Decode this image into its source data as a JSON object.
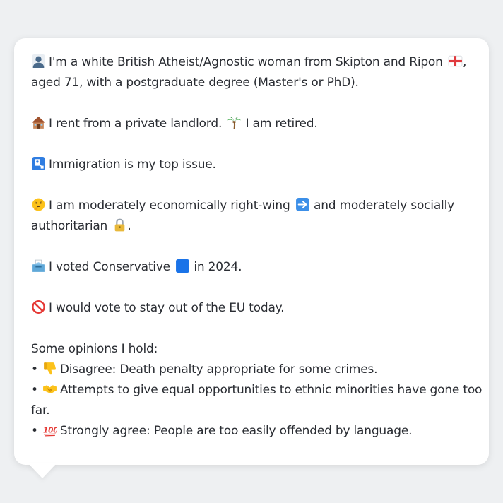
{
  "profile": {
    "intro_line1": "I'm a white British Atheist/Agnostic woman from Skipton and Ripon",
    "intro_line1_end": ",",
    "intro_line2": "aged 71, with a postgraduate degree (Master's or PhD).",
    "housing": "I rent from a private landlord.",
    "work": "I am retired.",
    "top_issue": "Immigration is my top issue.",
    "ideology_a": "I am moderately economically right-wing",
    "ideology_b": "and moderately socially",
    "ideology_c": "authoritarian",
    "ideology_c_end": ".",
    "vote_a": "I voted Conservative",
    "vote_b": "in 2024.",
    "eu": "I would vote to stay out of the EU today."
  },
  "opinions": {
    "heading": "Some opinions I hold:",
    "bullet": "•",
    "items": [
      {
        "line1": "Disagree: Death penalty appropriate for some crimes.",
        "line2": ""
      },
      {
        "line1": "Attempts to give equal opportunities to ethnic minorities have gone too",
        "line2": "far."
      },
      {
        "line1": "Strongly agree: People are too easily offended by language.",
        "line2": ""
      }
    ]
  },
  "icons": {
    "intro": "person-silhouette-icon",
    "flag": "england-flag-icon",
    "housing": "house-icon",
    "work": "palm-tree-icon",
    "top_issue": "passport-control-icon",
    "ideology": "thinking-face-icon",
    "economic": "right-arrow-icon",
    "social": "lock-icon",
    "vote": "ballot-box-icon",
    "party": "blue-square-icon",
    "eu": "prohibited-icon",
    "opinion_1": "thumbs-down-icon",
    "opinion_2": "handshake-icon",
    "opinion_3": "hundred-points-icon"
  },
  "colors": {
    "background": "#eef0f2",
    "bubble": "#ffffff",
    "text": "#2a2d33",
    "party_blue": "#1a73e8"
  }
}
